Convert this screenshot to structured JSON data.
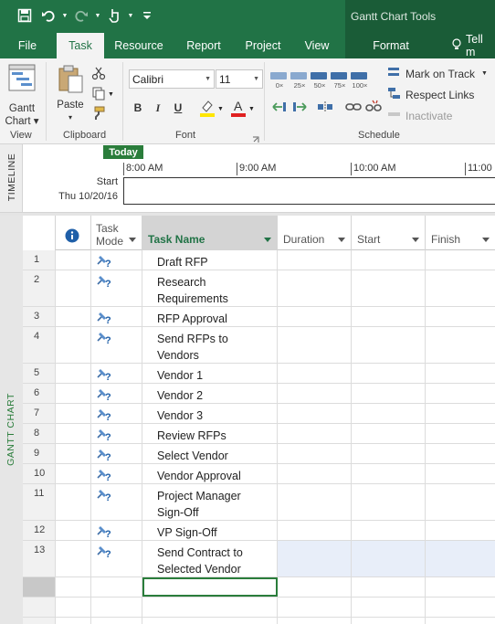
{
  "titlebar": {
    "context_title": "Gantt Chart Tools"
  },
  "tabs": [
    {
      "label": "File"
    },
    {
      "label": "Task"
    },
    {
      "label": "Resource"
    },
    {
      "label": "Report"
    },
    {
      "label": "Project"
    },
    {
      "label": "View"
    },
    {
      "label": "Format"
    },
    {
      "label": "Tell m"
    }
  ],
  "ribbon": {
    "view_group": {
      "button_line1": "Gantt",
      "button_line2": "Chart",
      "label": "View"
    },
    "clipboard_group": {
      "paste_label": "Paste",
      "label": "Clipboard"
    },
    "font_group": {
      "font_name": "Calibri",
      "font_size": "11",
      "bold": "B",
      "italic": "I",
      "underline": "U",
      "label": "Font"
    },
    "schedule_group": {
      "percent_buttons": [
        "0×",
        "25×",
        "50×",
        "75×",
        "100×"
      ],
      "mark_on_track": "Mark on Track",
      "respect_links": "Respect Links",
      "inactivate": "Inactivate",
      "label": "Schedule"
    }
  },
  "timeline": {
    "side_label": "TIMELINE",
    "today_label": "Today",
    "ticks": [
      "8:00 AM",
      "9:00 AM",
      "10:00 AM",
      "11:00"
    ],
    "start_label": "Start",
    "start_date": "Thu 10/20/16"
  },
  "grid": {
    "side_label": "GANTT CHART",
    "columns": {
      "task_mode_line1": "Task",
      "task_mode_line2": "Mode",
      "task_name": "Task Name",
      "duration": "Duration",
      "start": "Start",
      "finish": "Finish"
    },
    "rows": [
      {
        "id": "1",
        "name_lines": [
          "Draft RFP"
        ]
      },
      {
        "id": "2",
        "name_lines": [
          "Research",
          "Requirements"
        ]
      },
      {
        "id": "3",
        "name_lines": [
          "RFP Approval"
        ]
      },
      {
        "id": "4",
        "name_lines": [
          "Send RFPs to",
          "Vendors"
        ]
      },
      {
        "id": "5",
        "name_lines": [
          "Vendor 1"
        ]
      },
      {
        "id": "6",
        "name_lines": [
          "Vendor 2"
        ]
      },
      {
        "id": "7",
        "name_lines": [
          "Vendor 3"
        ]
      },
      {
        "id": "8",
        "name_lines": [
          "Review RFPs"
        ]
      },
      {
        "id": "9",
        "name_lines": [
          "Select Vendor"
        ]
      },
      {
        "id": "10",
        "name_lines": [
          "Vendor Approval"
        ]
      },
      {
        "id": "11",
        "name_lines": [
          "Project Manager",
          "Sign-Off"
        ]
      },
      {
        "id": "12",
        "name_lines": [
          "VP Sign-Off"
        ]
      },
      {
        "id": "13",
        "name_lines": [
          "Send Contract to",
          "Selected Vendor"
        ]
      }
    ]
  },
  "colors": {
    "brand_green": "#217346",
    "context_green": "#1a5c37",
    "today_green": "#2a7d3b",
    "highlight_blue": "#e8eef9"
  }
}
